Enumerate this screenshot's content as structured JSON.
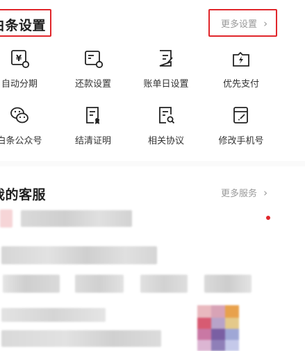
{
  "settings_section": {
    "title": "白条设置",
    "more_label": "更多设置",
    "chevron": "›"
  },
  "settings_items": [
    {
      "label": "自动分期",
      "icon": "yen-gear-icon"
    },
    {
      "label": "还款设置",
      "icon": "card-gear-icon"
    },
    {
      "label": "账单日设置",
      "icon": "bill-edit-icon"
    },
    {
      "label": "优先支付",
      "icon": "lightning-pay-icon"
    },
    {
      "label": "白条公众号",
      "icon": "wechat-icon"
    },
    {
      "label": "结清证明",
      "icon": "certificate-icon"
    },
    {
      "label": "相关协议",
      "icon": "agreement-search-icon"
    },
    {
      "label": "修改手机号",
      "icon": "phone-edit-icon"
    }
  ],
  "service_section": {
    "title": "我的客服",
    "more_label": "更多服务",
    "chevron": "›"
  },
  "colors": {
    "accent_red": "#e0262b",
    "text_main": "#1f1f1f",
    "text_muted": "#999999"
  }
}
